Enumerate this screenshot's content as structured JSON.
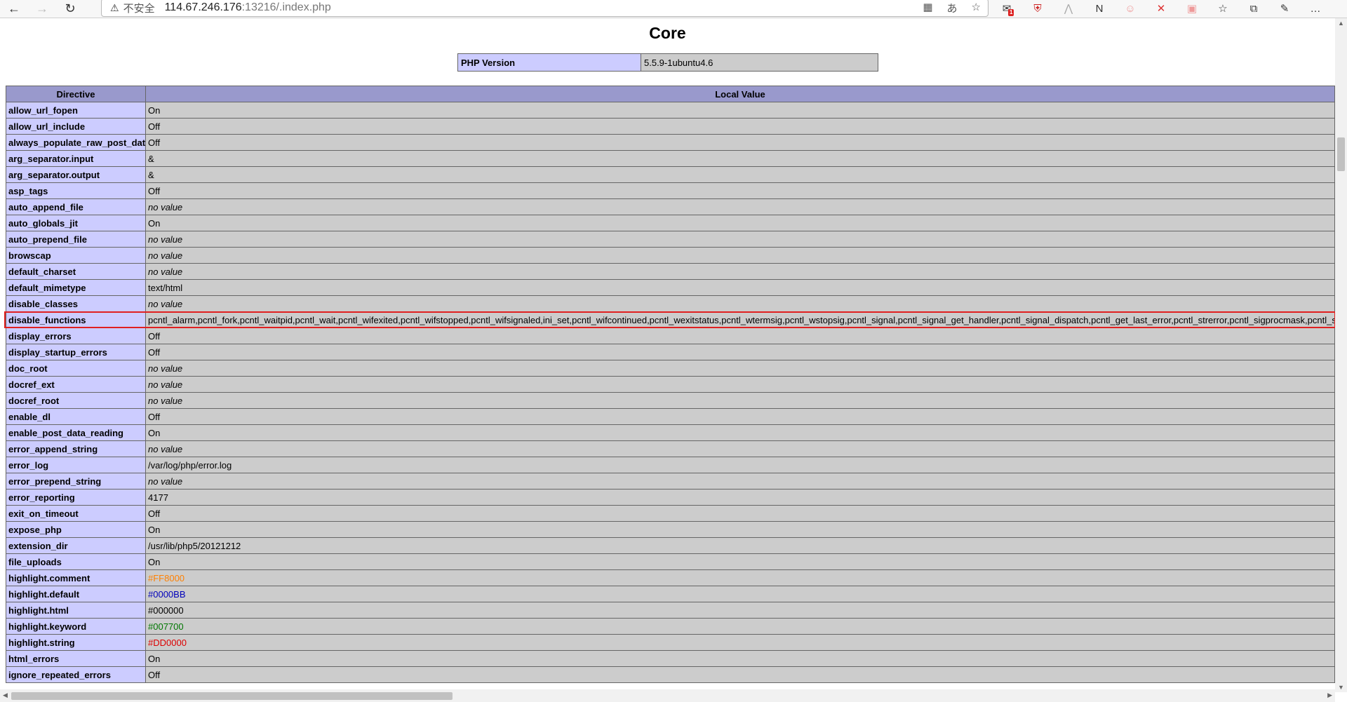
{
  "browser": {
    "security_label": "不安全",
    "url_host": "114.67.246.176",
    "url_rest": ":13216/.index.php",
    "extension_badge": "1"
  },
  "page": {
    "section_title": "Core",
    "php_version_label": "PHP Version",
    "php_version_value": "5.5.9-1ubuntu4.6",
    "columns": [
      "Directive",
      "Local Value"
    ],
    "rows": [
      {
        "directive": "allow_url_fopen",
        "value": "On"
      },
      {
        "directive": "allow_url_include",
        "value": "Off"
      },
      {
        "directive": "always_populate_raw_post_data",
        "value": "Off"
      },
      {
        "directive": "arg_separator.input",
        "value": "&"
      },
      {
        "directive": "arg_separator.output",
        "value": "&"
      },
      {
        "directive": "asp_tags",
        "value": "Off"
      },
      {
        "directive": "auto_append_file",
        "value": "no value",
        "italic": true
      },
      {
        "directive": "auto_globals_jit",
        "value": "On"
      },
      {
        "directive": "auto_prepend_file",
        "value": "no value",
        "italic": true
      },
      {
        "directive": "browscap",
        "value": "no value",
        "italic": true
      },
      {
        "directive": "default_charset",
        "value": "no value",
        "italic": true
      },
      {
        "directive": "default_mimetype",
        "value": "text/html"
      },
      {
        "directive": "disable_classes",
        "value": "no value",
        "italic": true
      },
      {
        "directive": "disable_functions",
        "value": "pcntl_alarm,pcntl_fork,pcntl_waitpid,pcntl_wait,pcntl_wifexited,pcntl_wifstopped,pcntl_wifsignaled,ini_set,pcntl_wifcontinued,pcntl_wexitstatus,pcntl_wtermsig,pcntl_wstopsig,pcntl_signal,pcntl_signal_get_handler,pcntl_signal_dispatch,pcntl_get_last_error,pcntl_strerror,pcntl_sigprocmask,pcntl_sigw"
      },
      {
        "directive": "display_errors",
        "value": "Off"
      },
      {
        "directive": "display_startup_errors",
        "value": "Off"
      },
      {
        "directive": "doc_root",
        "value": "no value",
        "italic": true
      },
      {
        "directive": "docref_ext",
        "value": "no value",
        "italic": true
      },
      {
        "directive": "docref_root",
        "value": "no value",
        "italic": true
      },
      {
        "directive": "enable_dl",
        "value": "Off"
      },
      {
        "directive": "enable_post_data_reading",
        "value": "On"
      },
      {
        "directive": "error_append_string",
        "value": "no value",
        "italic": true
      },
      {
        "directive": "error_log",
        "value": "/var/log/php/error.log"
      },
      {
        "directive": "error_prepend_string",
        "value": "no value",
        "italic": true
      },
      {
        "directive": "error_reporting",
        "value": "4177"
      },
      {
        "directive": "exit_on_timeout",
        "value": "Off"
      },
      {
        "directive": "expose_php",
        "value": "On"
      },
      {
        "directive": "extension_dir",
        "value": "/usr/lib/php5/20121212"
      },
      {
        "directive": "file_uploads",
        "value": "On"
      },
      {
        "directive": "highlight.comment",
        "value": "#FF8000",
        "color": "#FF8000"
      },
      {
        "directive": "highlight.default",
        "value": "#0000BB",
        "color": "#0000BB"
      },
      {
        "directive": "highlight.html",
        "value": "#000000",
        "color": "#000000"
      },
      {
        "directive": "highlight.keyword",
        "value": "#007700",
        "color": "#007700"
      },
      {
        "directive": "highlight.string",
        "value": "#DD0000",
        "color": "#DD0000"
      },
      {
        "directive": "html_errors",
        "value": "On"
      },
      {
        "directive": "ignore_repeated_errors",
        "value": "Off"
      }
    ]
  }
}
